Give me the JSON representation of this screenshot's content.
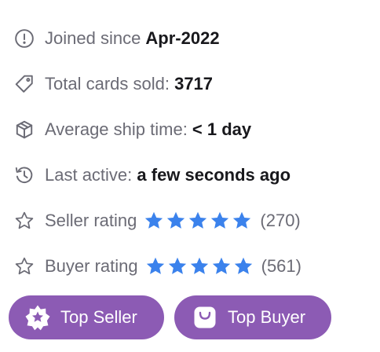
{
  "stats": {
    "joined": {
      "label": "Joined since ",
      "value": "Apr-2022",
      "icon": "info-circle-icon"
    },
    "cards_sold": {
      "label": "Total cards sold: ",
      "value": "3717",
      "icon": "tag-icon"
    },
    "ship_time": {
      "label": "Average ship time: ",
      "value": "< 1 day",
      "icon": "package-icon"
    },
    "last_active": {
      "label": "Last active: ",
      "value": "a few seconds ago",
      "icon": "history-icon"
    },
    "seller_rating": {
      "label": "Seller rating",
      "stars": 5,
      "count": "(270)",
      "icon": "star-outline-icon"
    },
    "buyer_rating": {
      "label": "Buyer rating",
      "stars": 5,
      "count": "(561)",
      "icon": "star-outline-icon"
    }
  },
  "badges": {
    "seller": {
      "label": "Top Seller",
      "icon": "award-star-icon"
    },
    "buyer": {
      "label": "Top Buyer",
      "icon": "shopping-bag-icon"
    }
  },
  "colors": {
    "star": "#3b82ec",
    "badge": "#8c5bb4",
    "label": "#6b6b75",
    "value": "#18181c",
    "icon": "#6b6b75"
  }
}
